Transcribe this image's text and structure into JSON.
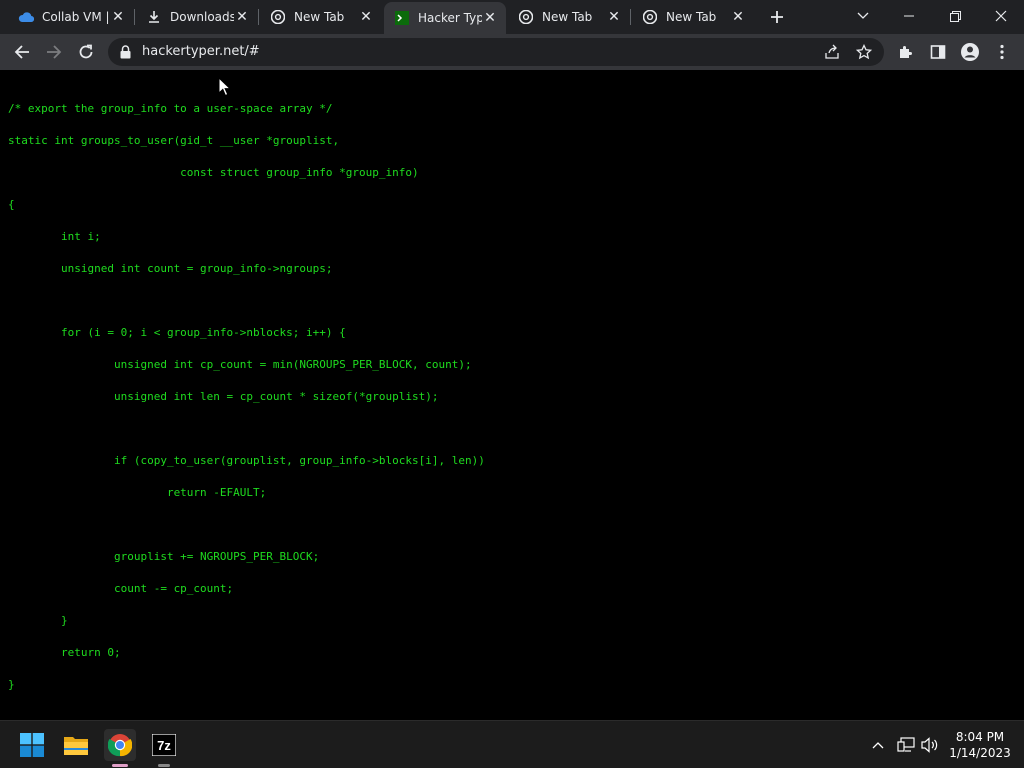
{
  "browser": {
    "tabs": [
      {
        "title": "Collab VM | ",
        "icon": "cloud-icon",
        "active": false
      },
      {
        "title": "Downloads",
        "icon": "download-icon",
        "active": false
      },
      {
        "title": "New Tab",
        "icon": "chrome-icon",
        "active": false
      },
      {
        "title": "Hacker Typer",
        "icon": "terminal-icon",
        "active": true
      },
      {
        "title": "New Tab",
        "icon": "chrome-icon",
        "active": false
      },
      {
        "title": "New Tab",
        "icon": "chrome-icon",
        "active": false
      }
    ],
    "url": "hackertyper.net/#"
  },
  "code_lines": [
    {
      "text": "/* export the group_info to a user-space array */"
    },
    {
      "text": "static int groups_to_user(gid_t __user *grouplist,"
    },
    {
      "text": "                          const struct group_info *group_info)"
    },
    {
      "text": "{"
    },
    {
      "text": "        int i;"
    },
    {
      "text": "        unsigned int count = group_info->ngroups;"
    },
    {
      "text": ""
    },
    {
      "text": "        for (i = 0; i < group_info->nblocks; i++) {"
    },
    {
      "text": "                unsigned int cp_count = min(NGROUPS_PER_BLOCK, count);"
    },
    {
      "text": "                unsigned int len = cp_count * sizeof(*grouplist);"
    },
    {
      "text": ""
    },
    {
      "text": "                if (copy_to_user(grouplist, group_info->blocks[i], len))"
    },
    {
      "text": "                        return -EFAULT;"
    },
    {
      "text": ""
    },
    {
      "text": "                grouplist += NGROUPS_PER_BLOCK;"
    },
    {
      "text": "                count -= cp_count;"
    },
    {
      "text": "        }"
    },
    {
      "text": "        return 0;"
    },
    {
      "text": "}"
    }
  ],
  "taskbar": {
    "apps": [
      "windows-start-icon",
      "file-explorer-icon",
      "chrome-icon",
      "7zip-icon"
    ],
    "time": "8:04 PM",
    "date": "1/14/2023"
  },
  "colors": {
    "code_text": "#1fdc1f",
    "background": "#000000",
    "tabstrip": "#202124",
    "toolbar": "#35363a"
  }
}
